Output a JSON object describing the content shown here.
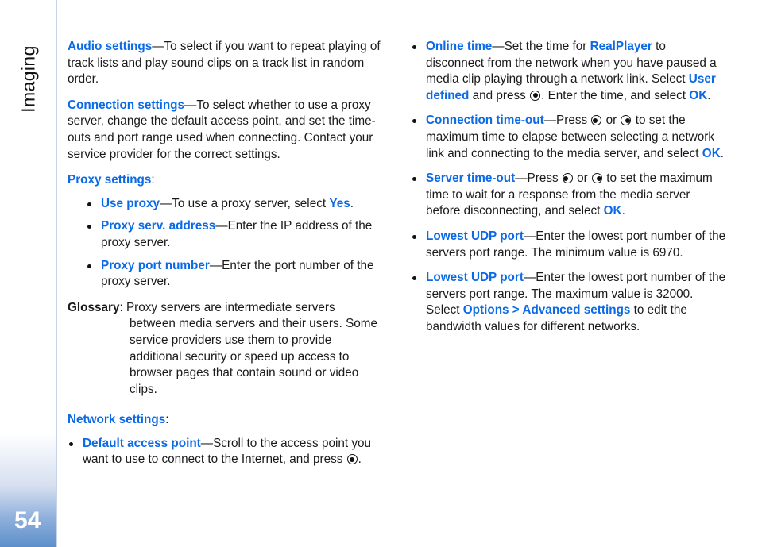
{
  "chapter": {
    "title": "Imaging",
    "page_number": "54"
  },
  "colors": {
    "keyword_blue": "#0b6ae6",
    "rail_bottom_blue": "#5e8fcb",
    "body_text": "#1a1a1a"
  },
  "left_column": {
    "audio_settings": {
      "keyword": "Audio settings",
      "text": "—To select if you want to repeat playing of track lists and play sound clips on a track list in random order."
    },
    "connection_settings": {
      "keyword": "Connection settings",
      "text": "—To select whether to use a proxy server, change the default access point, and set the time-outs and port range used when connecting. Contact your service provider for the correct settings."
    },
    "proxy_settings": {
      "keyword": "Proxy settings",
      "suffix": ":",
      "items": [
        {
          "keyword": "Use proxy",
          "text_before": "—To use a proxy server, select ",
          "inline_keyword": "Yes",
          "text_after": "."
        },
        {
          "keyword": "Proxy serv. address",
          "text_before": "—Enter the IP address of the proxy server.",
          "inline_keyword": "",
          "text_after": ""
        },
        {
          "keyword": "Proxy port number",
          "text_before": "—Enter the port number of the proxy server.",
          "inline_keyword": "",
          "text_after": ""
        }
      ]
    },
    "glossary": {
      "label": "Glossary",
      "separator": ": ",
      "text": "Proxy servers are intermediate servers between media servers and their users. Some service providers use them to provide additional security or speed up access to browser pages that contain sound or video clips."
    },
    "network_settings": {
      "keyword": "Network settings",
      "suffix": ":",
      "items": [
        {
          "keyword": "Default access point",
          "text_before": "—Scroll to the access point you want to use to connect to the Internet, and press ",
          "key_icon": "scroll-key-center-icon",
          "text_after": "."
        }
      ]
    }
  },
  "right_column": {
    "items": [
      {
        "keyword": "Online time",
        "seg1": "—Set the time for ",
        "kw2": "RealPlayer",
        "seg2": " to disconnect from the network when you have paused a media clip playing through a network link. Select ",
        "kw3": "User defined",
        "seg3": " and press ",
        "key_icon": "scroll-key-center-icon",
        "seg4": ". Enter the time, and select ",
        "kw4": "OK",
        "seg5": "."
      },
      {
        "keyword": "Connection time-out",
        "seg1": "—Press ",
        "key_icon_a": "scroll-key-left-icon",
        "seg2": " or ",
        "key_icon_b": "scroll-key-right-icon",
        "seg3": " to set the maximum time to elapse between selecting a network link and connecting to the media server, and select ",
        "kw4": "OK",
        "seg5": "."
      },
      {
        "keyword": "Server time-out",
        "seg1": "—Press ",
        "key_icon_a": "scroll-key-left-icon",
        "seg2": " or ",
        "key_icon_b": "scroll-key-right-icon",
        "seg3": " to set the maximum time to wait for a response from the media server before disconnecting, and select ",
        "kw4": "OK",
        "seg5": "."
      },
      {
        "keyword": "Lowest UDP port",
        "seg1": "—Enter the lowest port number of the servers port range. The minimum value is 6970."
      },
      {
        "keyword": "Lowest UDP port",
        "seg1": "—Enter the lowest port number of the servers port range. The maximum value is 32000. Select ",
        "kw3": "Options > Advanced settings",
        "seg3": " to edit the bandwidth values for different networks."
      }
    ]
  }
}
